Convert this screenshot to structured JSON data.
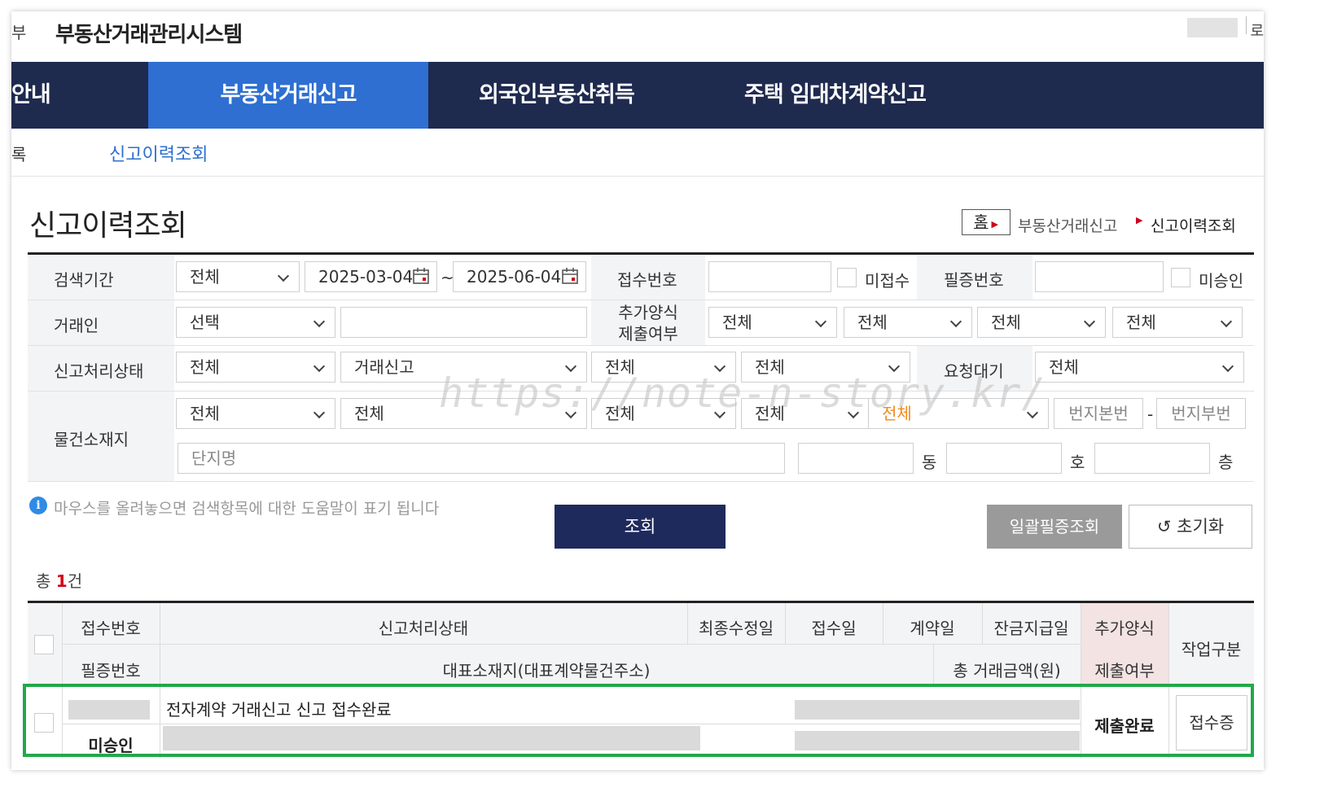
{
  "header": {
    "left_edge": "부",
    "title": "부동산거래관리시스템",
    "right_edge": "로"
  },
  "nav": {
    "items": [
      "안내",
      "부동산거래신고",
      "외국인부동산취득",
      "주택 임대차계약신고"
    ],
    "active_index": 1
  },
  "subnav": {
    "left_edge": "록",
    "active": "신고이력조회"
  },
  "page": {
    "title": "신고이력조회",
    "breadcrumb": {
      "home": "홈",
      "items": [
        "부동산거래신고",
        "신고이력조회"
      ]
    }
  },
  "search": {
    "period": {
      "label": "검색기간",
      "select": "전체",
      "start": "2025-03-04",
      "tilde": "~",
      "end": "2025-06-04"
    },
    "receipt_no": {
      "label": "접수번호",
      "value": "",
      "check_label": "미접수"
    },
    "cert_no": {
      "label": "필증번호",
      "value": "",
      "check_label": "미승인"
    },
    "trader": {
      "label": "거래인",
      "select": "선택",
      "value": ""
    },
    "extra_form": {
      "label_line1": "추가양식",
      "label_line2": "제출여부",
      "selects": [
        "전체",
        "전체",
        "전체",
        "전체"
      ]
    },
    "status": {
      "label": "신고처리상태",
      "selects": [
        "전체",
        "거래신고",
        "전체",
        "전체"
      ]
    },
    "request_wait": {
      "label": "요청대기",
      "select": "전체"
    },
    "location": {
      "label": "물건소재지",
      "selects": [
        "전체",
        "전체",
        "전체",
        "전체",
        "전체"
      ],
      "bonbun_placeholder": "번지본번",
      "dash": "-",
      "bubun_placeholder": "번지부번",
      "complex_placeholder": "단지명",
      "dong": "동",
      "ho": "호",
      "floor": "층"
    },
    "help_icon": "info-icon",
    "help_text": "마우스를 올려놓으면 검색항목에 대한 도움말이 표기 됩니다",
    "search_button": "조회",
    "bulk_button": "일괄필증조회",
    "reset_icon": "↺",
    "reset_button": "초기화"
  },
  "results": {
    "total_prefix": "총 ",
    "total_count": "1",
    "total_suffix": "건",
    "headers": {
      "receipt_no": "접수번호",
      "status": "신고처리상태",
      "last_modified": "최종수정일",
      "received": "접수일",
      "contract": "계약일",
      "balance_paid": "잔금지급일",
      "extra_form_line1": "추가양식",
      "extra_form_line2": "제출여부",
      "task": "작업구분",
      "cert_no": "필증번호",
      "address": "대표소재지(대표계약물건주소)",
      "total_amount": "총 거래금액(원)"
    },
    "rows": [
      {
        "status": "전자계약 거래신고 신고 접수완료",
        "cert_no": "미승인",
        "extra_form": "제출완료",
        "task_button": "접수증"
      }
    ]
  },
  "watermark": "https://note-n-story.kr/",
  "colors": {
    "nav_bg": "#1f2a4f",
    "nav_active": "#2e6fd1",
    "highlight_border": "#22a84a",
    "count_red": "#d0021b"
  }
}
